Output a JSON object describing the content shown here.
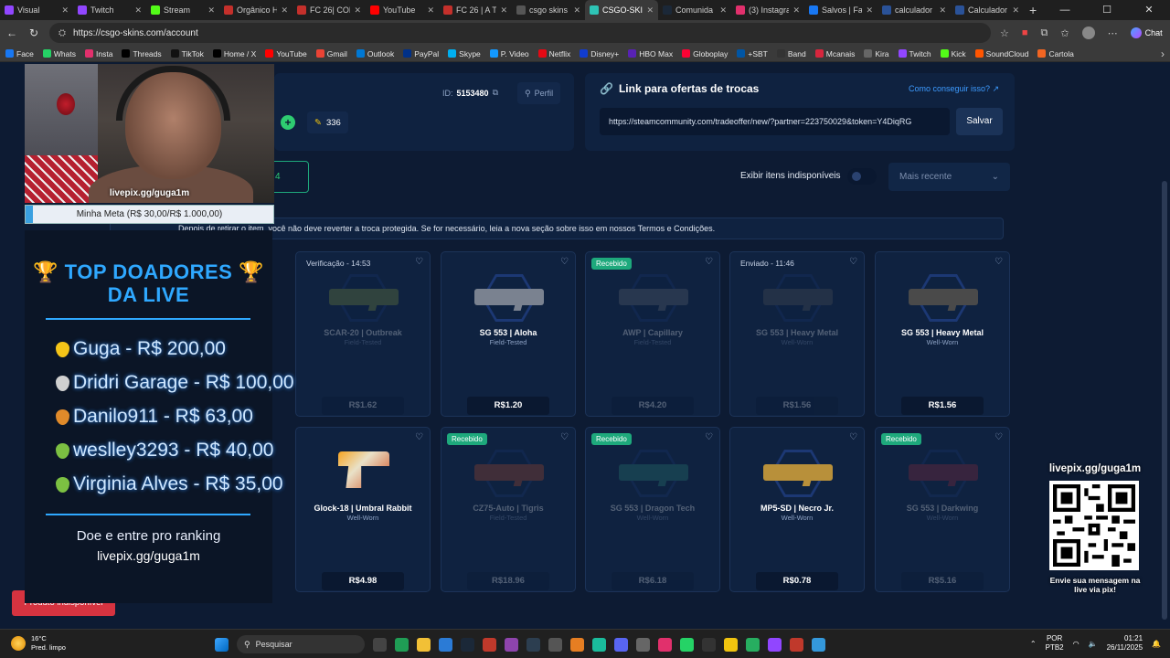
{
  "browser": {
    "tabs": [
      {
        "label": "Visual",
        "color": "#9146ff"
      },
      {
        "label": "Twitch",
        "color": "#9146ff"
      },
      {
        "label": "Stream",
        "color": "#53fc18"
      },
      {
        "label": "Orgânico H",
        "color": "#c4302b"
      },
      {
        "label": "FC 26| CON",
        "color": "#c4302b"
      },
      {
        "label": "YouTube",
        "color": "#ff0000"
      },
      {
        "label": "FC 26 | A T",
        "color": "#c4302b"
      },
      {
        "label": "csgo skins",
        "color": "#555555"
      },
      {
        "label": "CSGO-SKIN",
        "color": "#2ec4b6",
        "active": true
      },
      {
        "label": "Comunida",
        "color": "#1b2838"
      },
      {
        "label": "(3) Instagra",
        "color": "#e1306c"
      },
      {
        "label": "Salvos | Fa",
        "color": "#1877f2"
      },
      {
        "label": "calculador",
        "color": "#2a5298"
      },
      {
        "label": "Calculador",
        "color": "#2a5298"
      }
    ],
    "url": "https://csgo-skins.com/account",
    "chat_label": "Chat",
    "bookmarks": [
      {
        "label": "Face",
        "color": "#1877f2"
      },
      {
        "label": "Whats",
        "color": "#25d366"
      },
      {
        "label": "Insta",
        "color": "#e1306c"
      },
      {
        "label": "Threads",
        "color": "#000000"
      },
      {
        "label": "TikTok",
        "color": "#111111"
      },
      {
        "label": "Home / X",
        "color": "#000000"
      },
      {
        "label": "YouTube",
        "color": "#ff0000"
      },
      {
        "label": "Gmail",
        "color": "#ea4335"
      },
      {
        "label": "Outlook",
        "color": "#0078d4"
      },
      {
        "label": "PayPal",
        "color": "#003087"
      },
      {
        "label": "Skype",
        "color": "#00aff0"
      },
      {
        "label": "P. Video",
        "color": "#1399ff"
      },
      {
        "label": "Netflix",
        "color": "#e50914"
      },
      {
        "label": "Disney+",
        "color": "#113ccf"
      },
      {
        "label": "HBO Max",
        "color": "#5822b4"
      },
      {
        "label": "Globoplay",
        "color": "#fb0234"
      },
      {
        "label": "+SBT",
        "color": "#0055a4"
      },
      {
        "label": "Band",
        "color": "#333333"
      },
      {
        "label": "Mcanais",
        "color": "#d7263d"
      },
      {
        "label": "Kira",
        "color": "#666666"
      },
      {
        "label": "Twitch",
        "color": "#9146ff"
      },
      {
        "label": "Kick",
        "color": "#53fc18"
      },
      {
        "label": "SoundCloud",
        "color": "#ff5500"
      },
      {
        "label": "Cartola",
        "color": "#f26522"
      }
    ]
  },
  "account": {
    "id_label": "ID:",
    "id_value": "5153480",
    "profile_label": "Perfil",
    "coins": "336",
    "trade_title": "Link para ofertas de trocas",
    "how_link": "Como conseguir isso?",
    "trade_url": "https://steamcommunity.com/tradeoffer/new/?partner=223750029&token=Y4DiqRG",
    "save_label": "Salvar",
    "tab_count": "4",
    "show_unavailable_label": "Exibir itens indisponíveis",
    "sort_label": "Mais recente",
    "notice": "Depois de retirar o item, você não deve reverter a troca protegida. Se for necessário, leia a nova seção sobre isso em nossos Termos e Condições.",
    "unavailable_button": "Produto indisponível"
  },
  "items": [
    {
      "name": "SCAR-20 | Outbreak",
      "wear": "Field-Tested",
      "price": "R$1.62",
      "badge": "Verificação - 14:53",
      "badge_type": "status",
      "dim": true,
      "gun_color": "#8a9a3a"
    },
    {
      "name": "SG 553 | Aloha",
      "wear": "Field-Tested",
      "price": "R$1.20",
      "badge": "",
      "badge_type": "",
      "dim": false,
      "gun_color": "#7a8290"
    },
    {
      "name": "AWP | Capillary",
      "wear": "Field-Tested",
      "price": "R$4.20",
      "badge": "Recebido",
      "badge_type": "green",
      "dim": true,
      "gun_color": "#6b6f78"
    },
    {
      "name": "SG 553 | Heavy Metal",
      "wear": "Well-Worn",
      "price": "R$1.56",
      "badge": "Enviado - 11:46",
      "badge_type": "status",
      "dim": true,
      "gun_color": "#5a5a5a"
    },
    {
      "name": "SG 553 | Heavy Metal",
      "wear": "Well-Worn",
      "price": "R$1.56",
      "badge": "",
      "badge_type": "",
      "dim": false,
      "gun_color": "#4a4a4a"
    },
    {
      "name": "Glock-18 | Umbral Rabbit",
      "wear": "Well-Worn",
      "price": "R$4.98",
      "badge": "",
      "badge_type": "",
      "dim": false,
      "gun_color": "pistol"
    },
    {
      "name": "CZ75-Auto | Tigris",
      "wear": "Field-Tested",
      "price": "R$18.96",
      "badge": "Recebido",
      "badge_type": "green",
      "dim": true,
      "gun_color": "#c0502a"
    },
    {
      "name": "SG 553 | Dragon Tech",
      "wear": "Well-Worn",
      "price": "R$6.18",
      "badge": "Recebido",
      "badge_type": "green",
      "dim": true,
      "gun_color": "#2e8a7a"
    },
    {
      "name": "MP5-SD | Necro Jr.",
      "wear": "Well-Worn",
      "price": "R$0.78",
      "badge": "",
      "badge_type": "",
      "dim": false,
      "gun_color": "#b8903a"
    },
    {
      "name": "SG 553 | Darkwing",
      "wear": "Well-Worn",
      "price": "R$5.16",
      "badge": "Recebido",
      "badge_type": "green",
      "dim": true,
      "gun_color": "#a02a3a"
    }
  ],
  "stream": {
    "webcam_text": "livepix.gg/guga1m",
    "goal_text": "Minha Meta (R$ 30,00/R$ 1.000,00)",
    "goal_progress": 0.03,
    "donors_title_1": "🏆 TOP DOADORES 🏆",
    "donors_title_2": "DA LIVE",
    "donors": [
      {
        "text": "Guga - R$ 200,00",
        "medal": "#f5c518"
      },
      {
        "text": "Dridri Garage - R$ 100,00",
        "medal": "#d0d0d0"
      },
      {
        "text": "Danilo911 - R$ 63,00",
        "medal": "#e08a2a"
      },
      {
        "text": "weslley3293 - R$ 40,00",
        "medal": "#7cc042"
      },
      {
        "text": "Virginia Alves - R$ 35,00",
        "medal": "#7cc042"
      }
    ],
    "donors_cta": "Doe e entre pro ranking",
    "donors_link": "livepix.gg/guga1m",
    "qr_title": "livepix.gg/guga1m",
    "qr_cta": "Envie sua mensagem na live via pix!"
  },
  "taskbar": {
    "temp": "16°C",
    "weather": "Pred. limpo",
    "search": "Pesquisar",
    "lang1": "POR",
    "lang2": "PTB2",
    "time": "01:21",
    "date": "26/11/2025"
  }
}
